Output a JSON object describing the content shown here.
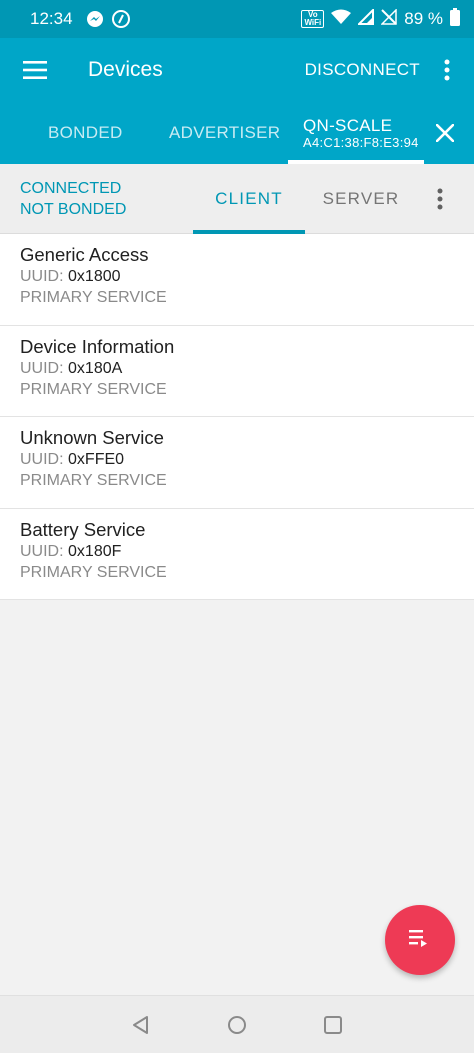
{
  "status_bar": {
    "time": "12:34",
    "volte_line1": "Vo",
    "volte_line2": "WiFi",
    "battery": "89 %"
  },
  "app_bar": {
    "title": "Devices",
    "disconnect_label": "DISCONNECT"
  },
  "device_tabs": [
    {
      "label": "BONDED"
    },
    {
      "label": "ADVERTISER"
    },
    {
      "label": "QN-SCALE",
      "address": "A4:C1:38:F8:E3:94"
    }
  ],
  "connection": {
    "state": "CONNECTED",
    "bond_state": "NOT BONDED"
  },
  "role_tabs": [
    {
      "label": "CLIENT"
    },
    {
      "label": "SERVER"
    }
  ],
  "uuid_prefix": "UUID:",
  "services": [
    {
      "name": "Generic Access",
      "uuid": "0x1800",
      "type": "PRIMARY SERVICE"
    },
    {
      "name": "Device Information",
      "uuid": "0x180A",
      "type": "PRIMARY SERVICE"
    },
    {
      "name": "Unknown Service",
      "uuid": "0xFFE0",
      "type": "PRIMARY SERVICE"
    },
    {
      "name": "Battery Service",
      "uuid": "0x180F",
      "type": "PRIMARY SERVICE"
    }
  ],
  "colors": {
    "primary": "#00a6c8",
    "status_bar": "#0097b4",
    "accent": "#ee3a55"
  },
  "icons": [
    "menu-icon",
    "more-vert-icon",
    "close-icon",
    "playlist-icon",
    "back-icon",
    "home-icon",
    "recents-icon"
  ]
}
